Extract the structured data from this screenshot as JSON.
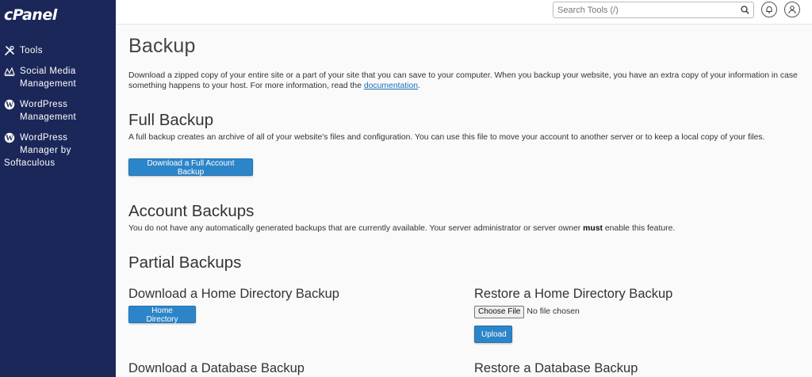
{
  "sidebar": {
    "logo": "cPanel",
    "items": [
      {
        "label": "Tools",
        "icon": "tools-icon"
      },
      {
        "label": "Social Media Management",
        "icon": "social-media-icon"
      },
      {
        "label": "WordPress Management",
        "icon": "wordpress-icon"
      },
      {
        "label_main": "WordPress Manager by",
        "label_tail": "Softaculous",
        "icon": "wordpress-icon"
      }
    ]
  },
  "header": {
    "search_placeholder": "Search Tools (/)"
  },
  "page": {
    "title": "Backup",
    "intro": "Download a zipped copy of your entire site or a part of your site that you can save to your computer. When you backup your website, you have an extra copy of your information in case something happens to your host. For more information, read the",
    "intro_link": "documentation",
    "intro_end": "."
  },
  "full_backup": {
    "heading": "Full Backup",
    "description": "A full backup creates an archive of all of your website's files and configuration. You can use this file to move your account to another server or to keep a local copy of your files.",
    "button": "Download a Full Account Backup"
  },
  "account_backups": {
    "heading": "Account Backups",
    "description_before": "You do not have any automatically generated backups that are currently available. Your server administrator or server owner",
    "description_bold": "must",
    "description_after": "enable this feature."
  },
  "partial_backups": {
    "heading": "Partial Backups",
    "download_home_heading": "Download a Home Directory Backup",
    "home_directory_button": "Home Directory",
    "restore_home_heading": "Restore a Home Directory Backup",
    "choose_file_button": "Choose File",
    "file_status": "No file chosen",
    "upload_button": "Upload",
    "download_db_heading": "Download a Database Backup",
    "restore_db_heading": "Restore a Database Backup"
  },
  "colors": {
    "sidebar_bg": "#1b2759",
    "button_bg": "#2d85c9",
    "link": "#1a6fb5"
  }
}
